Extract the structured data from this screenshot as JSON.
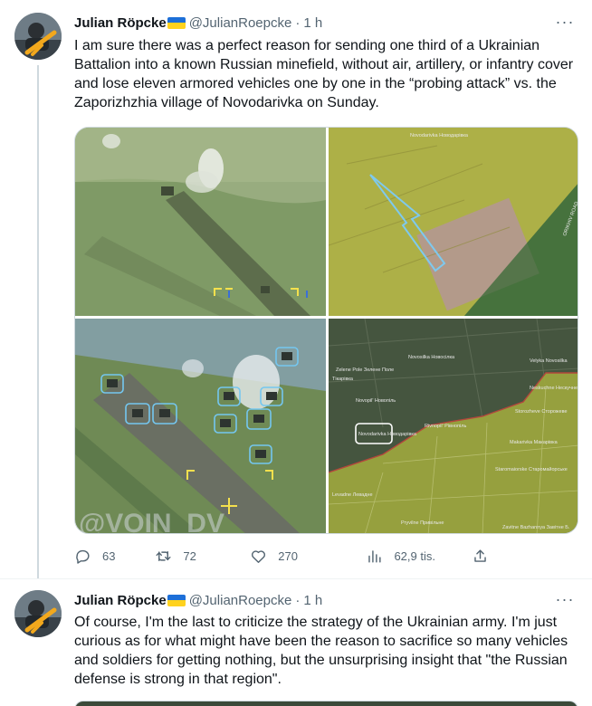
{
  "tweets": [
    {
      "author": {
        "name": "Julian Röpcke",
        "handle": "@JulianRoepcke",
        "flag": "ukraine-flag-icon"
      },
      "time": "1 h",
      "text": "I am sure there was a perfect reason for sending one third of a Ukrainian Battalion into a known Russian minefield, without air, artillery, or infantry cover and lose eleven armored vehicles one by one in the “probing attack” vs. the Zaporizhzhia village of Novodarivka on Sunday.",
      "media": {
        "watermark": "@VOIN_DV",
        "map_top_labels": [
          "Novodarivka Новодарівка",
          "ORIKHIV ROAD"
        ],
        "map_bottom_labels": [
          "Novosilka Новосілка",
          "Zelene Pole Зелене Поле",
          "Тікарівка",
          "Novopil' Новопіль",
          "Novodarivka Новодарівка",
          "Rivnopil' Рівнопіль",
          "Velyka Novosilka",
          "Neskuchne Нескучне",
          "Storozheve Сторожеве",
          "Makarivka Макарівка",
          "Staromaiorske Старомайорське",
          "Levadne Левадне",
          "Pryvilne Привільне",
          "Zavitne Bazhannya Завітне Б."
        ]
      },
      "stats": {
        "replies": "63",
        "retweets": "72",
        "likes": "270",
        "views": "62,9 tis."
      }
    },
    {
      "author": {
        "name": "Julian Röpcke",
        "handle": "@JulianRoepcke",
        "flag": "ukraine-flag-icon"
      },
      "time": "1 h",
      "text": "Of course, I'm the last to criticize the strategy of the Ukrainian army. I'm just curious as for what might have been the reason to sacrifice so many vehicles and soldiers for getting nothing, but the unsurprising insight that \"the Russian defense is strong in that region\"."
    }
  ],
  "ui": {
    "more_glyph": "···",
    "dot": "·"
  },
  "colors": {
    "text": "#0f1419",
    "muted": "#536471",
    "border": "#cfd9de",
    "flag_blue": "#1d6fd8",
    "flag_yellow": "#ffd21e"
  }
}
